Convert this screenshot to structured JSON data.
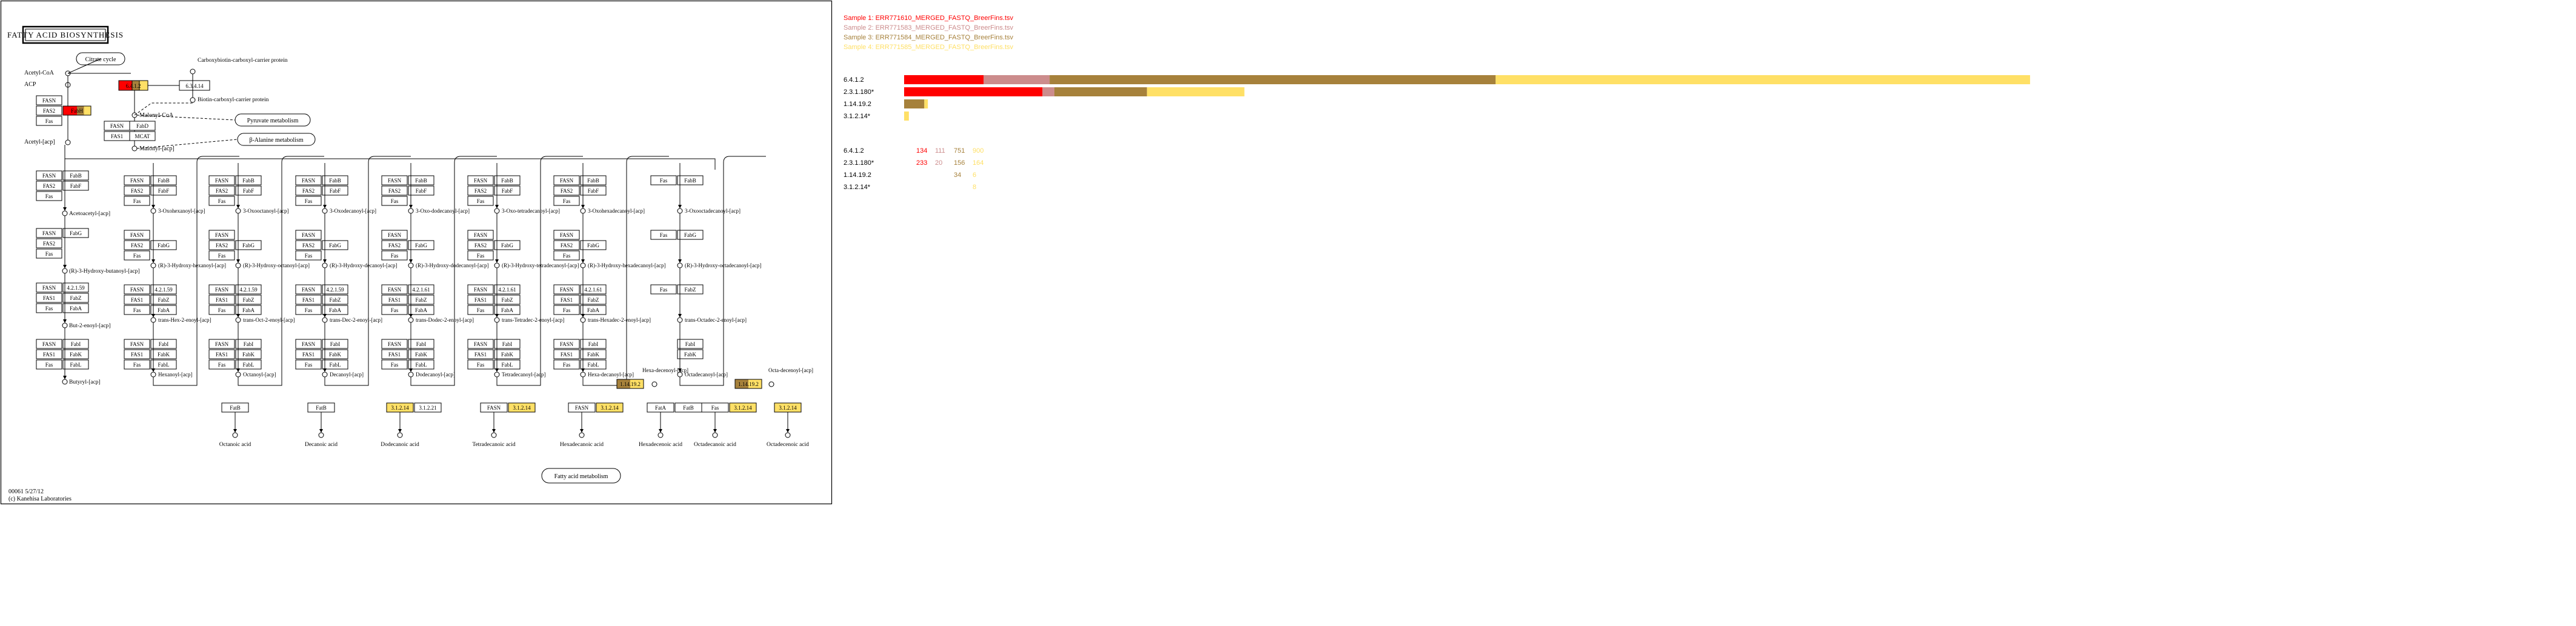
{
  "map": {
    "title": "FATTY ACID BIOSYNTHESIS",
    "footer_id": "00061 5/27/12",
    "footer_copyright": "(c) Kanehisa Laboratories"
  },
  "compounds": {
    "acetyl_coa": "Acetyl-CoA",
    "acp": "ACP",
    "acetyl_acp": "Acetyl-[acp]",
    "malonyl_coa": "Malonyl-CoA",
    "malonyl_acp": "Malonyl-[acp]",
    "carboxybiotin": "Carboxybiotin-carboxyl-carrier protein",
    "biotin_ccp": "Biotin-carboxyl-carrier protein",
    "acetoacetyl_acp": "Acetoacetyl-[acp]",
    "hydroxybutanoyl": "(R)-3-Hydroxy-butanoyl-[acp]",
    "butenoyl": "But-2-enoyl-[acp]",
    "butyryl": "Butyryl-[acp]",
    "hexanoyl": "Hexanoyl-[acp]",
    "octanoyl": "Octanoyl-[acp]",
    "decanoyl": "Decanoyl-[acp]",
    "dodecanoyl": "Dodecanoyl-[acp]",
    "tetradecanoyl": "Tetradecanoyl-[acp]",
    "hexadecanoyl": "Hexa-decanoyl-[acp]",
    "hexadecenoyl": "Hexa-decenoyl-[acp]",
    "octadecanoyl": "Octadecanoyl-[acp]",
    "octadecenoyl": "Octa-decenoyl-[acp]",
    "octanoic": "Octanoic acid",
    "decanoic": "Decanoic acid",
    "dodecanoic": "Dodecanoic acid",
    "tetradecanoic": "Tetradecanoic acid",
    "hexadecanoic": "Hexadecanoic acid",
    "hexadecenoic": "Hexadecenoic acid",
    "octadecanoic": "Octadecanoic acid",
    "octadecenoic": "Octadecenoic acid",
    "oxo_hexanoyl": "3-Oxohexanoyl-[acp]",
    "oxo_octanoyl": "3-Oxooctanoyl-[acp]",
    "oxo_decanoyl": "3-Oxodecanoyl-[acp]",
    "oxo_dodecanoyl": "3-Oxo-dodecanoyl-[acp]",
    "oxo_tetradecanoyl": "3-Oxo-tetradecanoyl-[acp]",
    "oxo_hexadecanoyl": "3-Oxohexadecanoyl-[acp]",
    "oxo_octadecanoyl": "3-Oxooctadecanoyl-[acp]",
    "hydroxy_hexanoyl": "(R)-3-Hydroxy-hexanoyl-[acp]",
    "hydroxy_octanoyl": "(R)-3-Hydroxy-octanoyl-[acp]",
    "hydroxy_decanoyl": "(R)-3-Hydroxy-decanoyl-[acp]",
    "hydroxy_dodecanoyl": "(R)-3-Hydroxy-dodecanoyl-[acp]",
    "hydroxy_tetradecanoyl": "(R)-3-Hydroxy-tetradecanoyl-[acp]",
    "hydroxy_hexadecanoyl": "(R)-3-Hydroxy-hexadecanoyl-[acp]",
    "hydroxy_octadecanoyl": "(R)-3-Hydroxy-octadecanoyl-[acp]",
    "hexenoyl": "trans-Hex-2-enoyl-[acp]",
    "octenoyl": "trans-Oct-2-enoyl-[acp]",
    "decenoyl": "trans-Dec-2-enoyl-[acp]",
    "dodecenoyl": "trans-Dodec-2-enoyl-[acp]",
    "tetradecenoyl": "trans-Tetradec-2-enoyl-[acp]",
    "hexadecenoyl2": "trans-Hexadec-2-enoyl-[acp]",
    "octadecenoyl2": "trans-Octadec-2-enoyl-[acp]"
  },
  "pathways": {
    "citrate_cycle": "Citrate cycle",
    "pyruvate": "Pyruvate metabolism",
    "beta_alanine": "β-Alanine metabolism",
    "fatty_acid_metabolism": "Fatty acid metabolism"
  },
  "genes": {
    "fasn": "FASN",
    "fas1": "FAS1",
    "fas2": "FAS2",
    "fabd": "FabD",
    "fabh": "FabH",
    "fabf": "FabF",
    "fabb": "FabB",
    "fabg": "FabG",
    "fabz": "FabZ",
    "faba": "FabA",
    "fabi": "FabI",
    "fabk": "FabK",
    "fabl": "FabL",
    "fabv": "FabV",
    "mcat": "MCAT",
    "fata": "FatA",
    "fatb": "FatB",
    "ec_21190": "2.3.1.180",
    "ec_6412": "6.4.1.2",
    "ec_63414": "6.3.4.14",
    "ec_4211_59": "4.2.1.59",
    "ec_4211_61": "4.2.1.61",
    "ec_3_1_2_14": "3.1.2.14",
    "ec_3_1_2_21": "3.1.2.21",
    "ec_1_14_19_2": "1.14.19.2"
  },
  "legend": {
    "samples": [
      {
        "label": "Sample 1: ERR771610_MERGED_FASTQ_BreerFins.tsv",
        "color": "#ff0000"
      },
      {
        "label": "Sample 2: ERR771583_MERGED_FASTQ_BreerFins.tsv",
        "color": "#cc8c8c"
      },
      {
        "label": "Sample 3: ERR771584_MERGED_FASTQ_BreerFins.tsv",
        "color": "#a6813b"
      },
      {
        "label": "Sample 4: ERR771585_MERGED_FASTQ_BreerFins.tsv",
        "color": "#ffe066"
      }
    ]
  },
  "chart_data": {
    "type": "bar",
    "stacked": true,
    "orientation": "horizontal",
    "categories": [
      "6.4.1.2",
      "2.3.1.180*",
      "1.14.19.2",
      "3.1.2.14*"
    ],
    "series": [
      {
        "name": "Sample 1: ERR771610_MERGED_FASTQ_BreerFins.tsv",
        "color": "#ff0000",
        "values": [
          134,
          233,
          0,
          0
        ]
      },
      {
        "name": "Sample 2: ERR771583_MERGED_FASTQ_BreerFins.tsv",
        "color": "#cc8c8c",
        "values": [
          111,
          20,
          0,
          0
        ]
      },
      {
        "name": "Sample 3: ERR771584_MERGED_FASTQ_BreerFins.tsv",
        "color": "#a6813b",
        "values": [
          751,
          156,
          34,
          0
        ]
      },
      {
        "name": "Sample 4: ERR771585_MERGED_FASTQ_BreerFins.tsv",
        "color": "#ffe066",
        "values": [
          900,
          164,
          6,
          8
        ]
      }
    ],
    "table_labels": [
      [
        "134",
        "111",
        "751",
        "900"
      ],
      [
        "233",
        "20",
        "156",
        "164"
      ],
      [
        "",
        "",
        "34",
        "6"
      ],
      [
        "",
        "",
        "",
        "8"
      ]
    ]
  }
}
